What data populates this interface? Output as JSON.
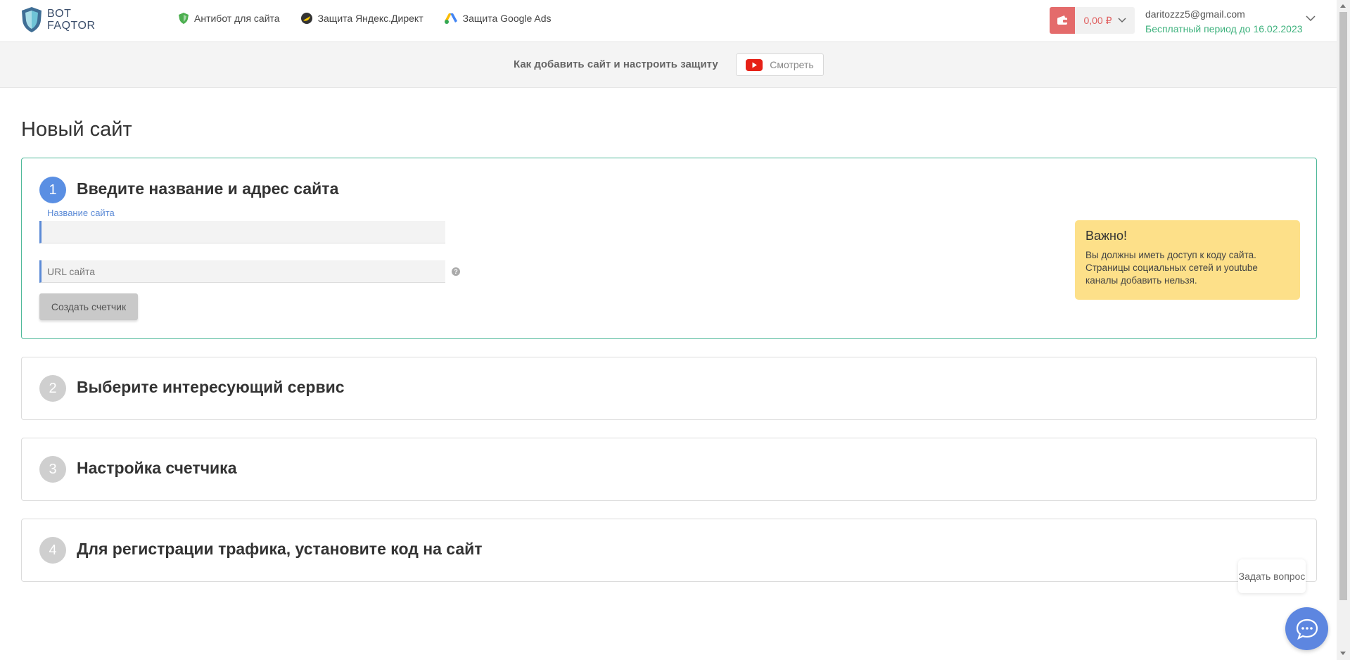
{
  "logo": {
    "line1": "BOT",
    "line2": "FAQTOR"
  },
  "nav": [
    {
      "label": "Антибот для сайта",
      "icon": "shield-icon"
    },
    {
      "label": "Защита Яндекс.Директ",
      "icon": "yandex-direct-icon"
    },
    {
      "label": "Защита Google Ads",
      "icon": "google-ads-icon"
    }
  ],
  "wallet": {
    "balance": "0,00 ₽"
  },
  "account": {
    "email": "daritozzz5@gmail.com",
    "period": "Бесплатный период до 16.02.2023"
  },
  "banner": {
    "text": "Как добавить сайт и настроить защиту",
    "button": "Смотреть"
  },
  "page_title": "Новый сайт",
  "steps": [
    {
      "num": "1",
      "title": "Введите название и адрес сайта"
    },
    {
      "num": "2",
      "title": "Выберите интересующий сервис"
    },
    {
      "num": "3",
      "title": "Настройка счетчика"
    },
    {
      "num": "4",
      "title": "Для регистрации трафика, установите код на сайт"
    }
  ],
  "form": {
    "site_name_label": "Название сайта",
    "site_name_value": "",
    "url_placeholder": "URL сайта",
    "help": "?",
    "create_button": "Создать счетчик"
  },
  "important": {
    "title": "Важно!",
    "text": "Вы должны иметь доступ к коду сайта. Страницы социальных сетей и youtube каналы добавить нельзя."
  },
  "chat": {
    "bubble": "Задать вопрос"
  },
  "colors": {
    "accent": "#5a8fe3",
    "success": "#3eb27d",
    "warning": "#fde089",
    "danger": "#e46b6b"
  }
}
